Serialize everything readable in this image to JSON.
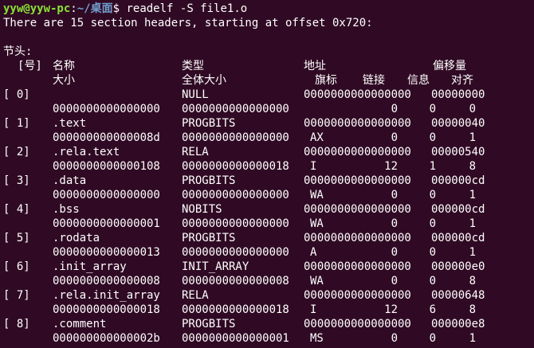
{
  "prompt": {
    "user_host": "yyw@yyw-pc",
    "path": "~/桌面",
    "symbol": "$",
    "command": "readelf -S file1.o"
  },
  "summary": "There are 15 section headers, starting at offset 0x720:",
  "section_title": "节头:",
  "headers": {
    "idx": "[号]",
    "name": "名称",
    "type": "类型",
    "addr": "地址",
    "offset": "偏移量",
    "size": "大小",
    "entsize": "全体大小",
    "flags": "旗标",
    "link": "链接",
    "info": "信息",
    "align": "对齐"
  },
  "sections": [
    {
      "idx": "[ 0]",
      "name": "",
      "type": "NULL",
      "addr": "0000000000000000",
      "offset": "00000000",
      "size": "0000000000000000",
      "entsize": "0000000000000000",
      "flags": "",
      "link": "0",
      "info": "0",
      "align": "0"
    },
    {
      "idx": "[ 1]",
      "name": ".text",
      "type": "PROGBITS",
      "addr": "0000000000000000",
      "offset": "00000040",
      "size": "000000000000008d",
      "entsize": "0000000000000000",
      "flags": "AX",
      "link": "0",
      "info": "0",
      "align": "1"
    },
    {
      "idx": "[ 2]",
      "name": ".rela.text",
      "type": "RELA",
      "addr": "0000000000000000",
      "offset": "00000540",
      "size": "0000000000000108",
      "entsize": "0000000000000018",
      "flags": "I",
      "link": "12",
      "info": "1",
      "align": "8"
    },
    {
      "idx": "[ 3]",
      "name": ".data",
      "type": "PROGBITS",
      "addr": "0000000000000000",
      "offset": "000000cd",
      "size": "0000000000000000",
      "entsize": "0000000000000000",
      "flags": "WA",
      "link": "0",
      "info": "0",
      "align": "1"
    },
    {
      "idx": "[ 4]",
      "name": ".bss",
      "type": "NOBITS",
      "addr": "0000000000000000",
      "offset": "000000cd",
      "size": "0000000000000001",
      "entsize": "0000000000000000",
      "flags": "WA",
      "link": "0",
      "info": "0",
      "align": "1"
    },
    {
      "idx": "[ 5]",
      "name": ".rodata",
      "type": "PROGBITS",
      "addr": "0000000000000000",
      "offset": "000000cd",
      "size": "0000000000000013",
      "entsize": "0000000000000000",
      "flags": "A",
      "link": "0",
      "info": "0",
      "align": "1"
    },
    {
      "idx": "[ 6]",
      "name": ".init_array",
      "type": "INIT_ARRAY",
      "addr": "0000000000000000",
      "offset": "000000e0",
      "size": "0000000000000008",
      "entsize": "0000000000000008",
      "flags": "WA",
      "link": "0",
      "info": "0",
      "align": "8"
    },
    {
      "idx": "[ 7]",
      "name": ".rela.init_array",
      "type": "RELA",
      "addr": "0000000000000000",
      "offset": "00000648",
      "size": "0000000000000018",
      "entsize": "0000000000000018",
      "flags": "I",
      "link": "12",
      "info": "6",
      "align": "8"
    },
    {
      "idx": "[ 8]",
      "name": ".comment",
      "type": "PROGBITS",
      "addr": "0000000000000000",
      "offset": "000000e8",
      "size": "000000000000002b",
      "entsize": "0000000000000001",
      "flags": "MS",
      "link": "0",
      "info": "0",
      "align": "1"
    }
  ]
}
